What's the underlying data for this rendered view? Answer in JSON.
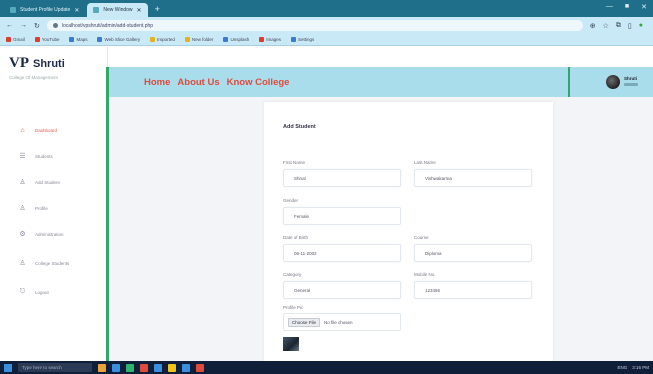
{
  "browser": {
    "tabs": [
      {
        "title": "Student Profile Update",
        "active": false
      },
      {
        "title": "New Window",
        "active": true
      }
    ],
    "new_tab": "+",
    "window_controls": [
      "—",
      "■",
      "✕"
    ],
    "url": "localhost/vpshruti/admin/add-student.php",
    "bookmarks": [
      "Gmail",
      "YouTube",
      "Maps",
      "Web Slice Gallery",
      "Imported",
      "New folder",
      "Unsplash",
      "Images",
      "Settings"
    ]
  },
  "sidebar": {
    "brand_vp": "VP",
    "brand_name": "Shruti",
    "brand_sub": "College Of Management",
    "items": [
      {
        "icon": "dashboard-icon",
        "glyph": "⌂",
        "label": "Dashboard",
        "active": true
      },
      {
        "icon": "student-icon",
        "glyph": "☰",
        "label": "Students",
        "active": false
      },
      {
        "icon": "user-icon",
        "glyph": "♙",
        "label": "Add Student",
        "active": false
      },
      {
        "icon": "user-icon",
        "glyph": "♙",
        "label": "Profile",
        "active": false
      },
      {
        "icon": "settings-icon",
        "glyph": "⚙",
        "label": "Administration",
        "active": false
      },
      {
        "icon": "user-icon",
        "glyph": "♙",
        "label": "College Students",
        "active": false
      },
      {
        "icon": "logout-icon",
        "glyph": "⎋",
        "label": "Logout",
        "active": false
      }
    ]
  },
  "appbar": {
    "links": [
      "Home",
      "About Us",
      "Know College"
    ]
  },
  "user": {
    "name": "Shruti"
  },
  "form": {
    "title": "Add Student",
    "first_name_label": "First Name",
    "first_name_value": "Shruti",
    "last_name_label": "Last Name",
    "last_name_value": "Vishwakarma",
    "gender_label": "Gender",
    "gender_value": "Female",
    "dob_label": "Date of Birth",
    "dob_value": "06-11-2002",
    "course_label": "Course",
    "course_value": "Diploma",
    "category_label": "Category",
    "category_value": "General",
    "mobile_label": "Mobile No.",
    "mobile_value": "123456",
    "profile_label": "Profile Pic",
    "file_button": "Choose File",
    "file_name": "No file chosen"
  },
  "taskbar": {
    "search_placeholder": "Type here to search",
    "time": "3:16 PM",
    "lang": "ENG"
  }
}
